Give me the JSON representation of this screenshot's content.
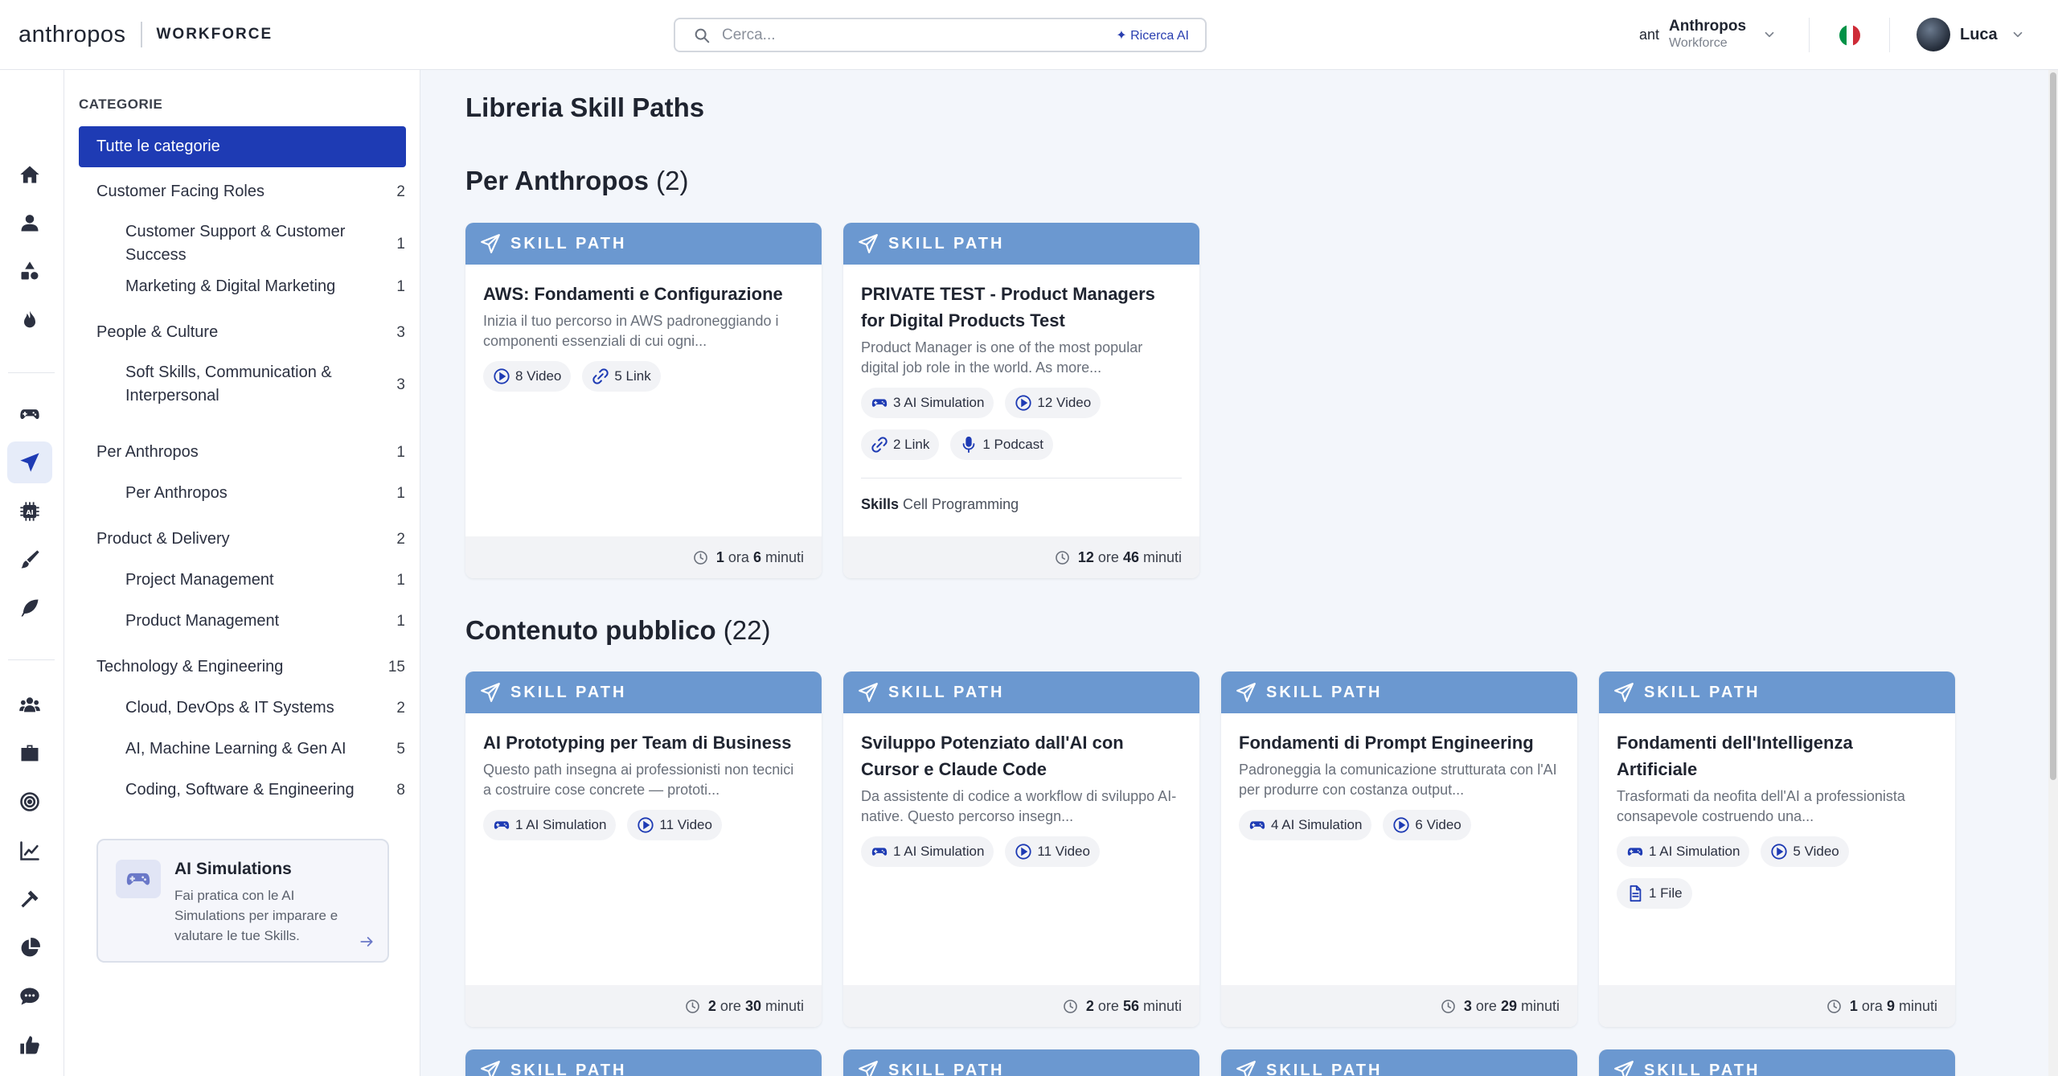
{
  "header": {
    "brand": "anthropos",
    "product": "WORKFORCE",
    "search_placeholder": "Cerca...",
    "ai_search": "✦ Ricerca AI",
    "org_logo": "ant",
    "org_name": "Anthropos",
    "org_sub": "Workforce",
    "user_name": "Luca",
    "flag_colors": [
      "#009246",
      "#ffffff",
      "#ce2b37"
    ]
  },
  "rail": {
    "icons": [
      "home-icon",
      "user-icon",
      "shapes-icon",
      "fire-icon",
      "gamepad-icon",
      "send-icon",
      "ai-chip-icon",
      "brush-icon",
      "feather-icon",
      "team-icon",
      "briefcase-icon",
      "target-icon",
      "chart-icon",
      "hammer-icon",
      "pie-icon",
      "chat-icon",
      "thumbs-up-icon"
    ],
    "active": "send-icon"
  },
  "categories": {
    "title": "CATEGORIE",
    "all": "Tutte le categorie",
    "items": [
      {
        "label": "Customer Facing Roles",
        "count": "2",
        "sub": false
      },
      {
        "label": "Customer Support & Customer Success",
        "count": "1",
        "sub": true
      },
      {
        "label": "Marketing & Digital Marketing",
        "count": "1",
        "sub": true
      },
      {
        "label": "People & Culture",
        "count": "3",
        "sub": false
      },
      {
        "label": "Soft Skills, Communication & Interpersonal",
        "count": "3",
        "sub": true
      },
      {
        "label": "Per Anthropos",
        "count": "1",
        "sub": false
      },
      {
        "label": "Per Anthropos",
        "count": "1",
        "sub": true
      },
      {
        "label": "Product & Delivery",
        "count": "2",
        "sub": false
      },
      {
        "label": "Project Management",
        "count": "1",
        "sub": true
      },
      {
        "label": "Product Management",
        "count": "1",
        "sub": true
      },
      {
        "label": "Technology & Engineering",
        "count": "15",
        "sub": false
      },
      {
        "label": "Cloud, DevOps & IT Systems",
        "count": "2",
        "sub": true
      },
      {
        "label": "AI, Machine Learning & Gen AI",
        "count": "5",
        "sub": true
      },
      {
        "label": "Coding, Software & Engineering",
        "count": "8",
        "sub": true
      }
    ],
    "sim_card": {
      "title": "AI Simulations",
      "desc": "Fai pratica con le AI Simulations per imparare e valutare le tue Skills."
    }
  },
  "main": {
    "title": "Libreria Skill Paths",
    "tag": "SKILL PATH",
    "sections": [
      {
        "title": "Per Anthropos",
        "count": "(2)",
        "cards": [
          {
            "title": "AWS: Fondamenti e Configurazione",
            "desc": "Inizia il tuo percorso in AWS padroneggiando i componenti essenziali di cui ogni...",
            "chips": [
              {
                "icon": "video-icon",
                "label": "8 Video"
              },
              {
                "icon": "link-icon",
                "label": "5 Link"
              }
            ],
            "skills_label": "",
            "skills": "",
            "dur_a": "1",
            "dur_a_unit": "ora",
            "dur_b": "6",
            "dur_b_unit": "minuti"
          },
          {
            "title": "PRIVATE TEST - Product Managers for Digital Products Test",
            "desc": "Product Manager is one of the most popular digital job role in the world. As more...",
            "chips": [
              {
                "icon": "gamepad-icon",
                "label": "3 AI Simulation"
              },
              {
                "icon": "video-icon",
                "label": "12 Video"
              },
              {
                "icon": "link-icon",
                "label": "2 Link"
              },
              {
                "icon": "mic-icon",
                "label": "1 Podcast"
              }
            ],
            "skills_label": "Skills",
            "skills": "Cell Programming",
            "dur_a": "12",
            "dur_a_unit": "ore",
            "dur_b": "46",
            "dur_b_unit": "minuti"
          }
        ]
      },
      {
        "title": "Contenuto pubblico",
        "count": "(22)",
        "cards": [
          {
            "title": "AI Prototyping per Team di Business",
            "desc": "Questo path insegna ai professionisti non tecnici a costruire cose concrete — prototi...",
            "chips": [
              {
                "icon": "gamepad-icon",
                "label": "1 AI Simulation"
              },
              {
                "icon": "video-icon",
                "label": "11 Video"
              }
            ],
            "skills_label": "",
            "skills": "",
            "dur_a": "2",
            "dur_a_unit": "ore",
            "dur_b": "30",
            "dur_b_unit": "minuti"
          },
          {
            "title": "Sviluppo Potenziato dall'AI con Cursor e Claude Code",
            "desc": "Da assistente di codice a workflow di sviluppo AI-native. Questo percorso insegn...",
            "chips": [
              {
                "icon": "gamepad-icon",
                "label": "1 AI Simulation"
              },
              {
                "icon": "video-icon",
                "label": "11 Video"
              }
            ],
            "skills_label": "",
            "skills": "",
            "dur_a": "2",
            "dur_a_unit": "ore",
            "dur_b": "56",
            "dur_b_unit": "minuti"
          },
          {
            "title": "Fondamenti di Prompt Engineering",
            "desc": "Padroneggia la comunicazione strutturata con l'AI per produrre con costanza output...",
            "chips": [
              {
                "icon": "gamepad-icon",
                "label": "4 AI Simulation"
              },
              {
                "icon": "video-icon",
                "label": "6 Video"
              }
            ],
            "skills_label": "",
            "skills": "",
            "dur_a": "3",
            "dur_a_unit": "ore",
            "dur_b": "29",
            "dur_b_unit": "minuti"
          },
          {
            "title": "Fondamenti dell'Intelligenza Artificiale",
            "desc": "Trasformati da neofita dell'AI a professionista consapevole costruendo una...",
            "chips": [
              {
                "icon": "gamepad-icon",
                "label": "1 AI Simulation"
              },
              {
                "icon": "video-icon",
                "label": "5 Video"
              },
              {
                "icon": "file-icon",
                "label": "1 File"
              }
            ],
            "skills_label": "",
            "skills": "",
            "dur_a": "1",
            "dur_a_unit": "ora",
            "dur_b": "9",
            "dur_b_unit": "minuti"
          }
        ]
      }
    ]
  }
}
